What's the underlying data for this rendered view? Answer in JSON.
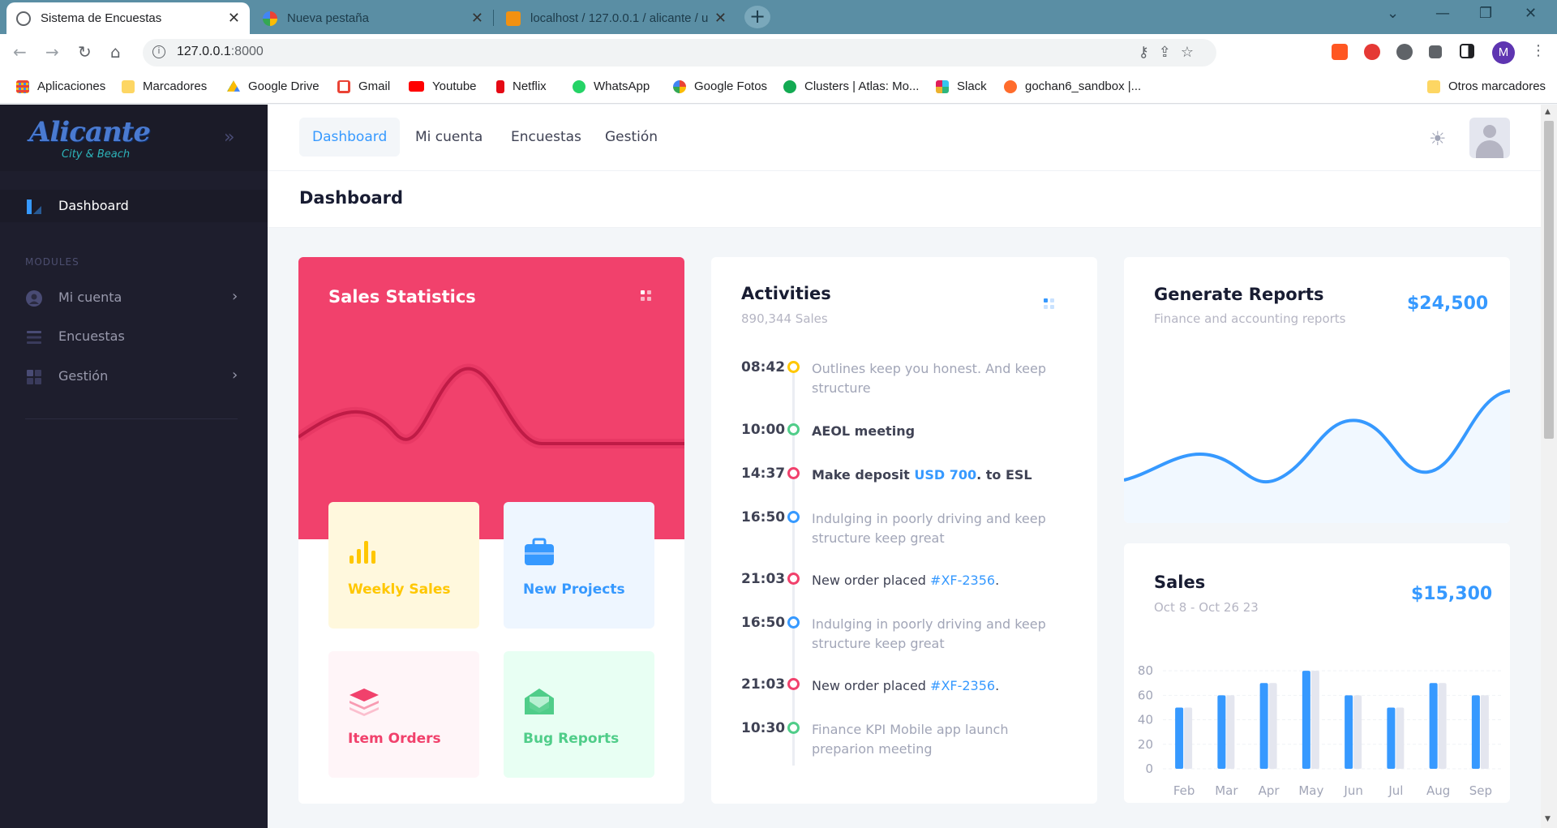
{
  "browser": {
    "tabs": [
      {
        "title": "Sistema de Encuestas",
        "active": true
      },
      {
        "title": "Nueva pestaña",
        "active": false
      },
      {
        "title": "localhost / 127.0.0.1 / alicante / u",
        "active": false
      }
    ],
    "url_host": "127.0.0.1",
    "url_port": ":8000",
    "profile_initial": "M",
    "bookmarks": [
      {
        "label": "Aplicaciones"
      },
      {
        "label": "Marcadores"
      },
      {
        "label": "Google Drive"
      },
      {
        "label": "Gmail"
      },
      {
        "label": "Youtube"
      },
      {
        "label": "Netflix"
      },
      {
        "label": "WhatsApp"
      },
      {
        "label": "Google Fotos"
      },
      {
        "label": "Clusters | Atlas: Mo..."
      },
      {
        "label": "Slack"
      },
      {
        "label": "gochan6_sandbox |..."
      }
    ],
    "other_bookmarks": "Otros marcadores"
  },
  "sidebar": {
    "logo": "Alicante",
    "logo_sub": "City & Beach",
    "dashboard": "Dashboard",
    "section": "MODULES",
    "items": [
      {
        "label": "Mi cuenta",
        "has_arrow": true
      },
      {
        "label": "Encuestas",
        "has_arrow": false
      },
      {
        "label": "Gestión",
        "has_arrow": true
      }
    ]
  },
  "topnav": {
    "items": [
      "Dashboard",
      "Mi cuenta",
      "Encuestas",
      "Gestión"
    ],
    "active": "Dashboard"
  },
  "page_title": "Dashboard",
  "sales_statistics": {
    "title": "Sales Statistics",
    "tiles": [
      {
        "label": "Weekly Sales",
        "color": "#ffc700",
        "bg": "#fff8dd"
      },
      {
        "label": "New Projects",
        "color": "#3699ff",
        "bg": "#eef6ff"
      },
      {
        "label": "Item Orders",
        "color": "#f1416c",
        "bg": "#fff5f8"
      },
      {
        "label": "Bug Reports",
        "color": "#50cd89",
        "bg": "#e8fff3"
      }
    ]
  },
  "activities": {
    "title": "Activities",
    "subtitle": "890,344 Sales",
    "items": [
      {
        "time": "08:42",
        "color": "#ffc700",
        "text": "Outlines keep you honest. And keep structure",
        "style": "muted"
      },
      {
        "time": "10:00",
        "color": "#50cd89",
        "text": "AEOL meeting",
        "style": "bold"
      },
      {
        "time": "14:37",
        "color": "#f1416c",
        "pre": "Make deposit ",
        "link": "USD 700",
        "post": ". to ESL",
        "style": "bold"
      },
      {
        "time": "16:50",
        "color": "#3699ff",
        "text": "Indulging in poorly driving and keep structure keep great",
        "style": "muted"
      },
      {
        "time": "21:03",
        "color": "#f1416c",
        "pre": "New order placed ",
        "link": "#XF-2356",
        "post": ".",
        "style": "normal"
      },
      {
        "time": "16:50",
        "color": "#3699ff",
        "text": "Indulging in poorly driving and keep structure keep great",
        "style": "muted"
      },
      {
        "time": "21:03",
        "color": "#f1416c",
        "pre": "New order placed ",
        "link": "#XF-2356",
        "post": ".",
        "style": "normal"
      },
      {
        "time": "10:30",
        "color": "#50cd89",
        "text": "Finance KPI Mobile app launch preparion meeting",
        "style": "muted"
      }
    ]
  },
  "reports": {
    "title": "Generate Reports",
    "subtitle": "Finance and accounting reports",
    "amount": "$24,500"
  },
  "sales": {
    "title": "Sales",
    "subtitle": "Oct 8 - Oct 26 23",
    "amount": "$15,300"
  },
  "chart_data": {
    "type": "bar",
    "categories": [
      "Feb",
      "Mar",
      "Apr",
      "May",
      "Jun",
      "Jul",
      "Aug",
      "Sep"
    ],
    "series": [
      {
        "values": [
          50,
          60,
          70,
          80,
          60,
          50,
          70,
          60
        ],
        "color": "#3699ff"
      },
      {
        "values": [
          50,
          60,
          70,
          80,
          60,
          50,
          70,
          60
        ],
        "color": "#e4e6ef"
      }
    ],
    "yticks": [
      0,
      20,
      40,
      60,
      80
    ],
    "ylim": [
      0,
      90
    ]
  }
}
